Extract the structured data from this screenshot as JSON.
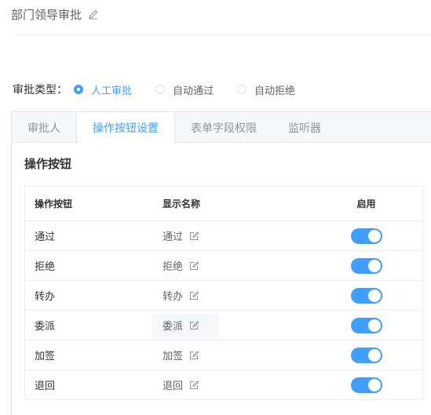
{
  "header": {
    "title": "部门领导审批"
  },
  "approval_type": {
    "label": "审批类型：",
    "options": [
      {
        "label": "人工审批",
        "checked": true
      },
      {
        "label": "自动通过",
        "checked": false
      },
      {
        "label": "自动拒绝",
        "checked": false
      }
    ]
  },
  "tabs": [
    {
      "label": "审批人",
      "active": false
    },
    {
      "label": "操作按钮设置",
      "active": true
    },
    {
      "label": "表单字段权限",
      "active": false
    },
    {
      "label": "监听器",
      "active": false
    }
  ],
  "section_title": "操作按钮",
  "table": {
    "columns": [
      "操作按钮",
      "显示名称",
      "启用"
    ],
    "rows": [
      {
        "button": "通过",
        "display": "通过",
        "enabled": true
      },
      {
        "button": "拒绝",
        "display": "拒绝",
        "enabled": true
      },
      {
        "button": "转办",
        "display": "转办",
        "enabled": true
      },
      {
        "button": "委派",
        "display": "委派",
        "enabled": true
      },
      {
        "button": "加签",
        "display": "加签",
        "enabled": true
      },
      {
        "button": "退回",
        "display": "退回",
        "enabled": true
      }
    ]
  },
  "colors": {
    "primary": "#409eff",
    "border": "#ebeef5",
    "text": "#303133"
  },
  "icons": {
    "edit": "edit-icon"
  }
}
